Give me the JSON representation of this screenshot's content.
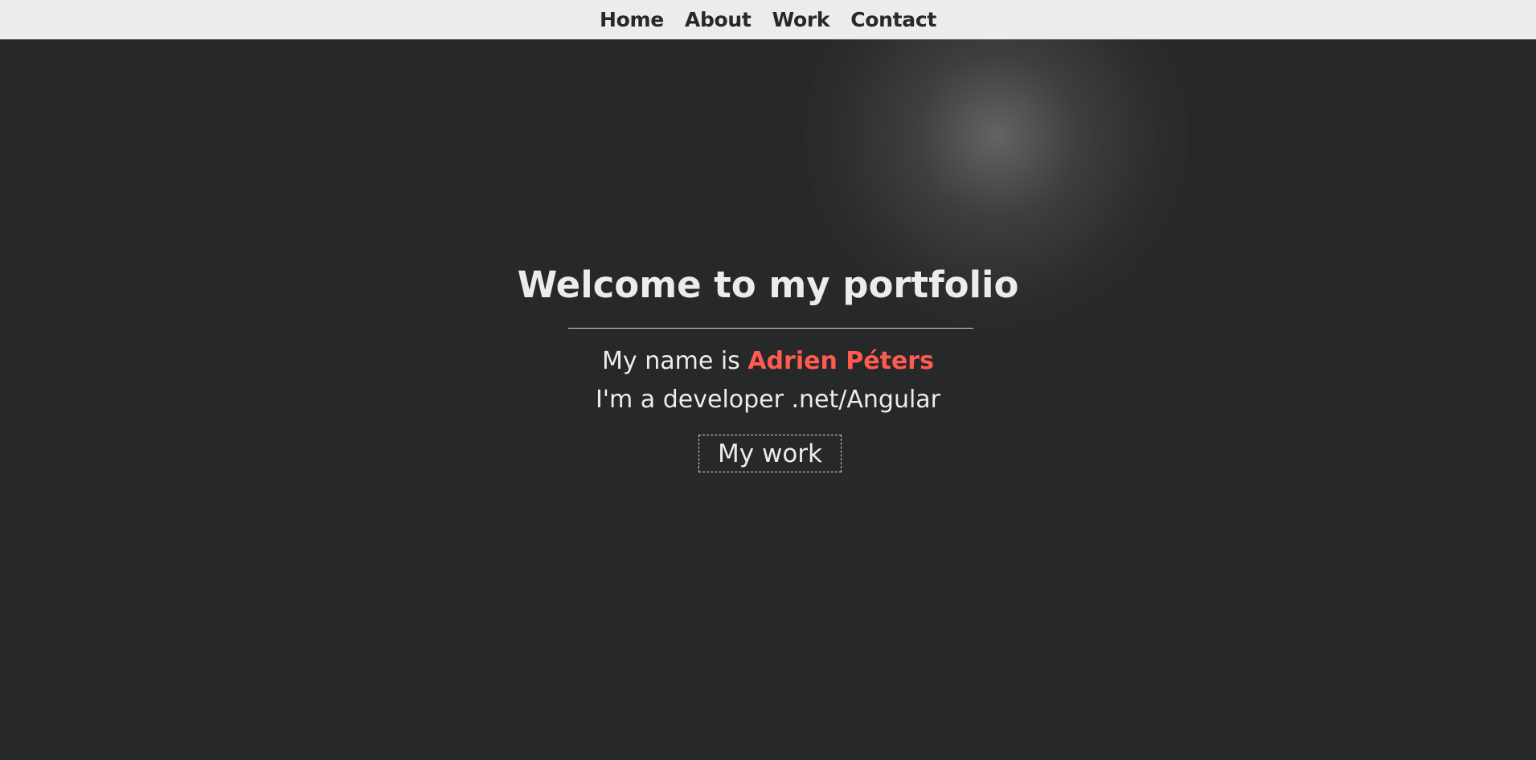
{
  "nav": {
    "items": [
      {
        "label": "Home"
      },
      {
        "label": "About"
      },
      {
        "label": "Work"
      },
      {
        "label": "Contact"
      }
    ]
  },
  "hero": {
    "title": "Welcome to my portfolio",
    "intro_prefix": "My name is ",
    "name": "Adrien Péters",
    "role": "I'm a developer .net/Angular",
    "cta_label": "My work"
  },
  "colors": {
    "background": "#27282a",
    "navbar": "#ececec",
    "text": "#ececec",
    "accent": "#ff5b4f"
  }
}
